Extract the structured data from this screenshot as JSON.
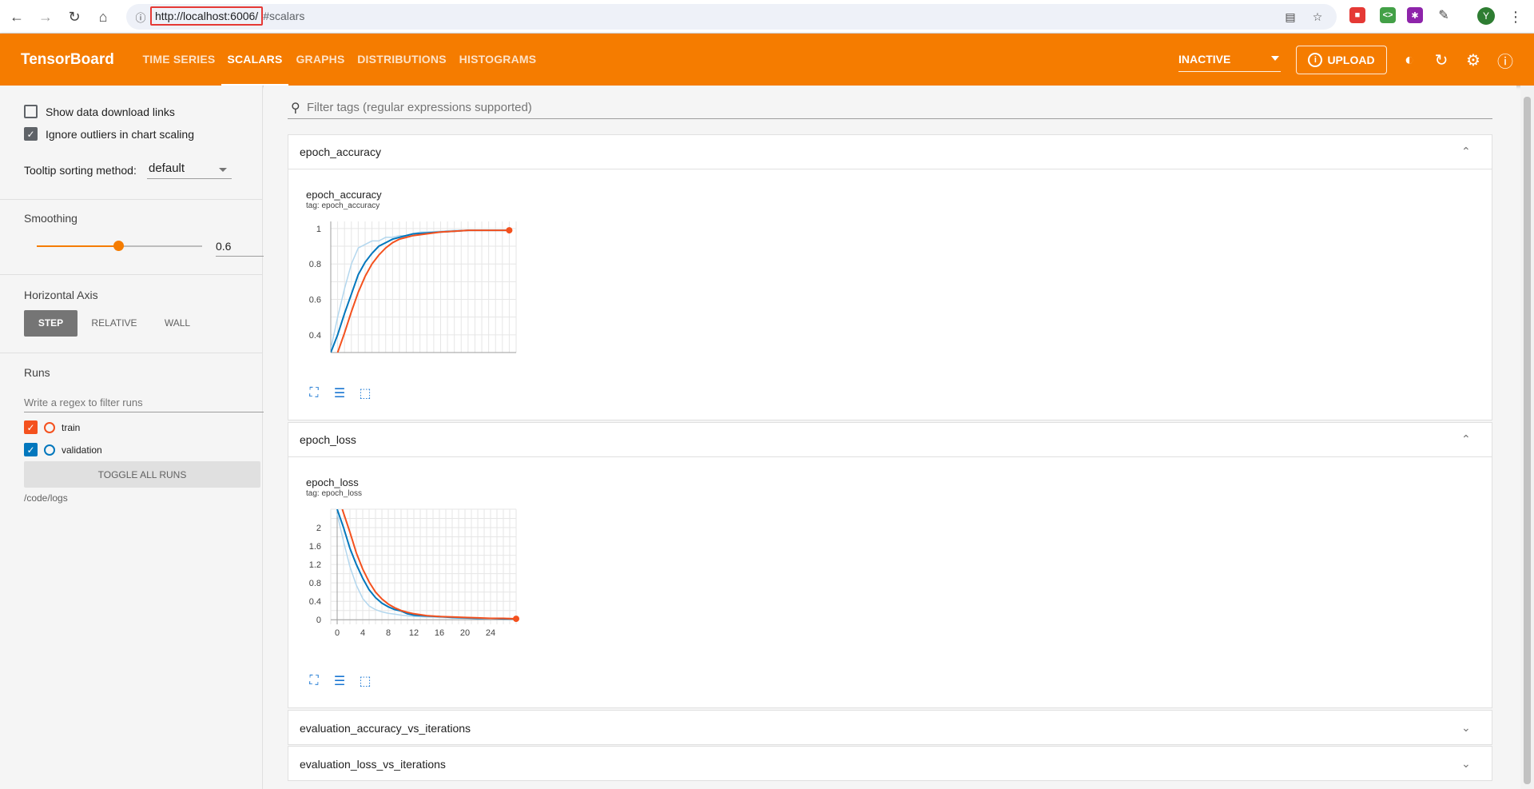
{
  "browser": {
    "url_host": "http://localhost:6006/",
    "url_path": "#scalars",
    "avatar_letter": "Y"
  },
  "header": {
    "logo": "TensorBoard",
    "tabs": [
      {
        "label": "TIME SERIES",
        "active": false
      },
      {
        "label": "SCALARS",
        "active": true
      },
      {
        "label": "GRAPHS",
        "active": false
      },
      {
        "label": "DISTRIBUTIONS",
        "active": false
      },
      {
        "label": "HISTOGRAMS",
        "active": false
      }
    ],
    "status_select": "INACTIVE",
    "upload_label": "UPLOAD"
  },
  "sidebar": {
    "show_download_links": {
      "label": "Show data download links",
      "checked": false
    },
    "ignore_outliers": {
      "label": "Ignore outliers in chart scaling",
      "checked": true
    },
    "tooltip_label": "Tooltip sorting method:",
    "tooltip_value": "default",
    "smoothing_title": "Smoothing",
    "smoothing_value": "0.6",
    "smoothing_fraction": 0.6,
    "horizontal_axis_title": "Horizontal Axis",
    "axis_options": [
      "STEP",
      "RELATIVE",
      "WALL"
    ],
    "axis_selected": "STEP",
    "runs_title": "Runs",
    "runs_filter_placeholder": "Write a regex to filter runs",
    "runs": [
      {
        "name": "train",
        "checked": true,
        "color": "#f4511e"
      },
      {
        "name": "validation",
        "checked": true,
        "color": "#0277bd"
      }
    ],
    "toggle_all_label": "TOGGLE ALL RUNS",
    "logdir": "/code/logs"
  },
  "main": {
    "filter_placeholder": "Filter tags (regular expressions supported)",
    "sections": [
      {
        "name": "epoch_accuracy",
        "expanded": true,
        "chart_title": "epoch_accuracy",
        "tag": "tag: epoch_accuracy"
      },
      {
        "name": "epoch_loss",
        "expanded": true,
        "chart_title": "epoch_loss",
        "tag": "tag: epoch_loss"
      },
      {
        "name": "evaluation_accuracy_vs_iterations",
        "expanded": false
      },
      {
        "name": "evaluation_loss_vs_iterations",
        "expanded": false
      }
    ]
  },
  "chart_data": [
    {
      "type": "line",
      "title": "epoch_accuracy",
      "xlabel": "",
      "ylabel": "",
      "xlim": [
        0,
        27
      ],
      "ylim": [
        0.3,
        1.04
      ],
      "xticks": [
        0,
        2,
        4,
        6,
        8,
        10,
        12,
        14,
        16,
        18,
        20,
        22,
        24,
        26
      ],
      "yticks": [
        0.4,
        0.6,
        0.8,
        1
      ],
      "series": [
        {
          "name": "train",
          "color": "#f4511e",
          "x": [
            1,
            2,
            3,
            4,
            5,
            6,
            7,
            8,
            9,
            10,
            12,
            14,
            16,
            18,
            20,
            22,
            24,
            26
          ],
          "values": [
            0.3,
            0.41,
            0.53,
            0.64,
            0.73,
            0.8,
            0.85,
            0.89,
            0.92,
            0.94,
            0.96,
            0.97,
            0.98,
            0.985,
            0.99,
            0.99,
            0.99,
            0.99
          ]
        },
        {
          "name": "validation",
          "color": "#0277bd",
          "x": [
            0,
            1,
            2,
            3,
            4,
            5,
            6,
            7,
            8,
            9,
            10,
            12,
            14,
            16,
            18,
            20,
            22,
            24,
            26
          ],
          "values": [
            0.3,
            0.4,
            0.52,
            0.63,
            0.74,
            0.81,
            0.86,
            0.9,
            0.92,
            0.94,
            0.95,
            0.97,
            0.975,
            0.98,
            0.985,
            0.99,
            0.99,
            0.99,
            0.99
          ]
        },
        {
          "name": "",
          "color": "#b3d7ee",
          "x": [
            0,
            1,
            2,
            3,
            4,
            5,
            6,
            7,
            8,
            9,
            10,
            11,
            12,
            13,
            14,
            16,
            18,
            20,
            22,
            24,
            26
          ],
          "values": [
            0.32,
            0.5,
            0.66,
            0.8,
            0.89,
            0.91,
            0.93,
            0.93,
            0.95,
            0.95,
            0.96,
            0.96,
            0.97,
            0.98,
            0.98,
            0.985,
            0.99,
            0.99,
            0.99,
            0.99,
            0.99
          ]
        }
      ]
    },
    {
      "type": "line",
      "title": "epoch_loss",
      "xlabel": "",
      "ylabel": "",
      "xlim": [
        -1,
        28
      ],
      "ylim": [
        -0.1,
        2.4
      ],
      "xticks": [
        0,
        4,
        8,
        12,
        16,
        20,
        24
      ],
      "yticks": [
        0,
        0.4,
        0.8,
        1.2,
        1.6,
        2
      ],
      "series": [
        {
          "name": "train",
          "color": "#f4511e",
          "x": [
            0.8,
            2,
            3,
            4,
            5,
            6,
            7,
            8,
            9,
            10,
            11,
            12,
            14,
            16,
            18,
            20,
            22,
            24,
            26,
            28
          ],
          "values": [
            2.4,
            1.9,
            1.45,
            1.1,
            0.82,
            0.6,
            0.45,
            0.34,
            0.26,
            0.2,
            0.16,
            0.13,
            0.09,
            0.07,
            0.06,
            0.05,
            0.04,
            0.03,
            0.03,
            0.02
          ]
        },
        {
          "name": "validation",
          "color": "#0277bd",
          "x": [
            0,
            1,
            2,
            3,
            4,
            5,
            6,
            7,
            8,
            9,
            10,
            11,
            12,
            14,
            16,
            18,
            20,
            22,
            24,
            26,
            28
          ],
          "values": [
            2.4,
            2.0,
            1.55,
            1.2,
            0.9,
            0.65,
            0.48,
            0.36,
            0.28,
            0.22,
            0.19,
            0.13,
            0.1,
            0.08,
            0.07,
            0.05,
            0.04,
            0.03,
            0.03,
            0.02,
            0.02
          ]
        },
        {
          "name": "",
          "color": "#b3d7ee",
          "x": [
            0,
            1,
            2,
            3,
            4,
            5,
            6,
            7,
            8,
            9,
            10,
            12,
            14,
            16,
            18,
            20,
            24,
            28
          ],
          "values": [
            2.3,
            1.7,
            1.15,
            0.75,
            0.46,
            0.3,
            0.22,
            0.17,
            0.14,
            0.12,
            0.1,
            0.07,
            0.06,
            0.05,
            0.04,
            0.03,
            0.02,
            0.02
          ]
        }
      ]
    }
  ]
}
